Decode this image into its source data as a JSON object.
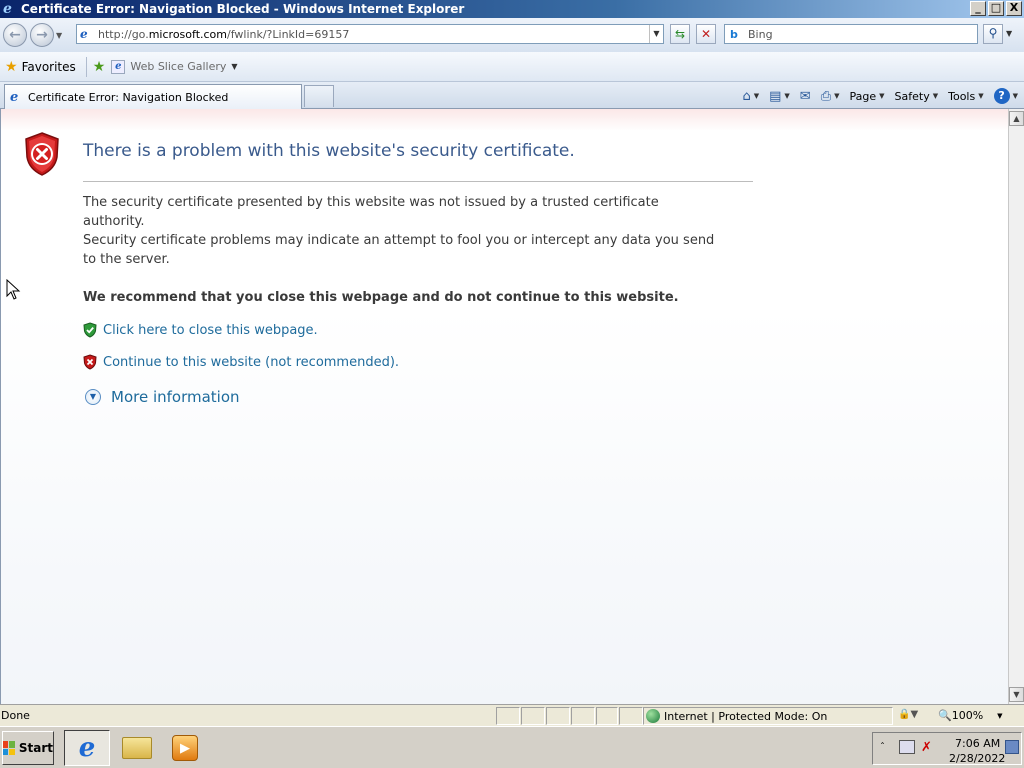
{
  "window": {
    "title": "Certificate Error: Navigation Blocked - Windows Internet Explorer",
    "buttons": [
      "_",
      "□",
      "X"
    ]
  },
  "address_bar": {
    "url_prefix": "http://go.",
    "url_domain": "microsoft.com",
    "url_suffix": "/fwlink/?LinkId=69157"
  },
  "search": {
    "placeholder": "Bing",
    "provider_icon": "b"
  },
  "favorites_bar": {
    "favorites_label": "Favorites",
    "web_slice_label": "Web Slice Gallery"
  },
  "tabs": [
    {
      "label": "Certificate Error: Navigation Blocked"
    }
  ],
  "command_bar": {
    "page_label": "Page",
    "safety_label": "Safety",
    "tools_label": "Tools",
    "help_symbol": "?"
  },
  "page": {
    "heading": "There is a problem with this website's security certificate.",
    "paragraph_1": "The security certificate presented by this website was not issued by a trusted certificate authority.",
    "paragraph_2": "Security certificate problems may indicate an attempt to fool you or intercept any data you send to the server.",
    "recommendation": "We recommend that you close this webpage and do not continue to this website.",
    "close_link": "Click here to close this webpage.",
    "continue_link": "Continue to this website (not recommended).",
    "more_info": "More information"
  },
  "status_bar": {
    "status": "Done",
    "zone": "Internet | Protected Mode: On",
    "zoom": "100%"
  },
  "taskbar": {
    "start_label": "Start",
    "clock_time": "7:06 AM",
    "clock_date": "2/28/2022"
  },
  "colors": {
    "title_bar": "#0a246a",
    "heading_text": "#3a5a8c",
    "link_text": "#1e6b9c",
    "error_red": "#d42020",
    "safe_green": "#2e9a3a"
  }
}
